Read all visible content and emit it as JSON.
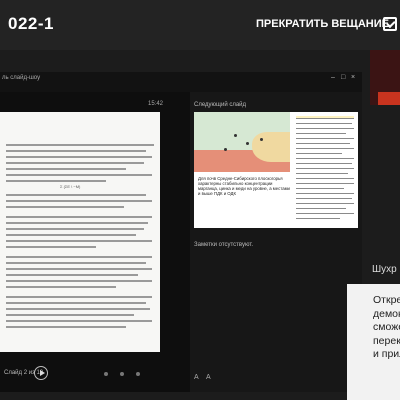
{
  "topbar": {
    "title": "022-1",
    "stop_label": "ПРЕКРАТИТЬ ВЕЩАНИЕ",
    "share_icon": "share-screen-icon"
  },
  "presenter": {
    "window_label": "ль слайд-шоу",
    "controls": [
      "–",
      "□",
      "×"
    ],
    "clock": "15:42",
    "slide_counter": "Слайд 2 из 10",
    "play_icon": "play-icon",
    "formula": "Σ (ΣE \\ −M)",
    "next_label": "Следующий слайд",
    "notes": "Заметки отсутствуют.",
    "next_slide": {
      "caption": "Для почв Средне-Сибирского плоскогорья характерны стабильно концентрации марганца, цинка и меди на уровне, а местами и выше ПДК и ОДК"
    },
    "font_controls": [
      "A",
      "A"
    ]
  },
  "participant": {
    "name": "Шухр"
  },
  "popover": {
    "lines": [
      "Открепи",
      "демонст",
      "сможете",
      "переклю",
      "и прилож"
    ]
  }
}
